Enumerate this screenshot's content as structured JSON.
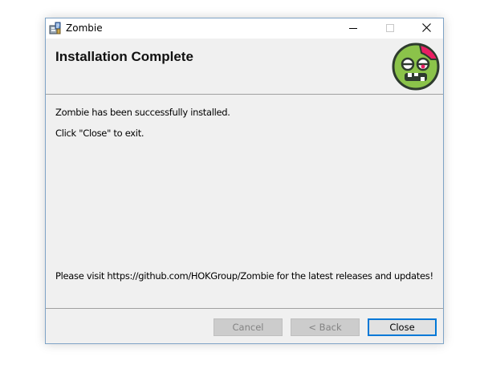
{
  "window": {
    "title": "Zombie",
    "app_icon": "installer-package-icon",
    "controls": {
      "minimize_icon": "minimize-icon",
      "maximize_icon": "maximize-icon",
      "close_icon": "close-icon"
    }
  },
  "banner": {
    "heading": "Installation Complete",
    "logo_icon": "zombie-face-icon"
  },
  "content": {
    "success_message": "Zombie has been successfully installed.",
    "exit_hint": "Click \"Close\" to exit.",
    "visit_message": "Please visit https://github.com/HOKGroup/Zombie for the latest releases and updates!"
  },
  "footer": {
    "cancel_label": "Cancel",
    "back_label": "< Back",
    "close_label": "Close"
  },
  "colors": {
    "focus_border": "#0078d7",
    "window_border": "#7ea3c6",
    "zombie_green": "#8bc34a",
    "zombie_brain": "#e91e63"
  }
}
